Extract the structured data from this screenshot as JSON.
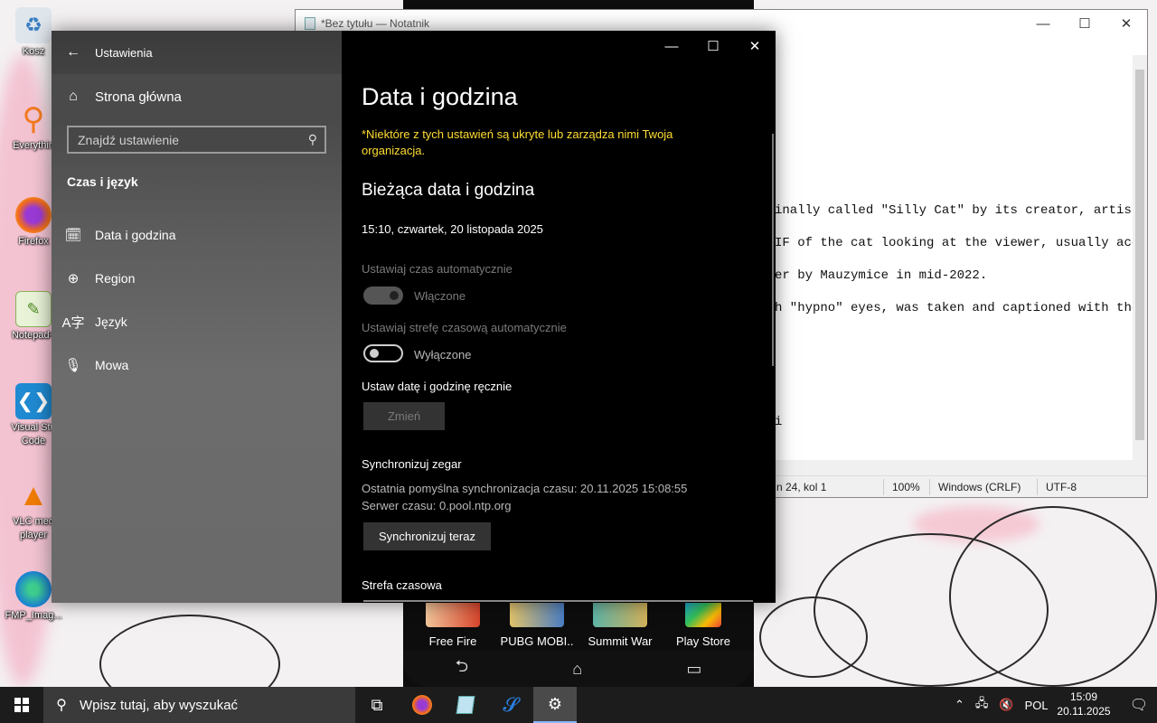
{
  "desktop": {
    "icons": [
      {
        "label": "Kosz",
        "icon": "recycle-bin-icon"
      },
      {
        "label": "Everythin",
        "icon": "everything-search-icon"
      },
      {
        "label": "Firefox",
        "icon": "firefox-icon"
      },
      {
        "label": "Notepad+",
        "icon": "notepad-plus-icon"
      },
      {
        "label": "Visual Stu Code",
        "icon": "vscode-icon"
      },
      {
        "label": "VLC med player",
        "icon": "vlc-icon"
      },
      {
        "label": "FMP_Imag...",
        "icon": "edge-icon"
      }
    ]
  },
  "phone": {
    "apps": [
      {
        "label": "Free Fire"
      },
      {
        "label": "PUBG MOBI.."
      },
      {
        "label": "Summit War"
      },
      {
        "label": "Play Store"
      }
    ]
  },
  "notepad": {
    "title": "*Bez tytułu — Notatnik",
    "lines": [
      "inally called \"Silly Cat\" by its creator, artist",
      "IF of the cat looking at the viewer, usually acco",
      "er by Mauzymice in mid-2022.",
      "h \"hypno\" eyes, was taken and captioned with the",
      "i"
    ],
    "status": {
      "position": "n 24, kol 1",
      "zoom": "100%",
      "line_ending": "Windows (CRLF)",
      "encoding": "UTF-8"
    }
  },
  "settings": {
    "window_title": "Ustawienia",
    "home": "Strona główna",
    "search_placeholder": "Znajdź ustawienie",
    "section": "Czas i język",
    "nav": [
      {
        "label": "Data i godzina",
        "icon": "calendar-clock-icon"
      },
      {
        "label": "Region",
        "icon": "globe-icon"
      },
      {
        "label": "Język",
        "icon": "language-icon"
      },
      {
        "label": "Mowa",
        "icon": "microphone-icon"
      }
    ],
    "page_title": "Data i godzina",
    "warning": "*Niektóre z tych ustawień są ukryte lub zarządza nimi Twoja organizacja.",
    "current_heading": "Bieżąca data i godzina",
    "current_datetime": "15:10, czwartek, 20 listopada 2025",
    "auto_time_label": "Ustawiaj czas automatycznie",
    "auto_time_state": "Włączone",
    "auto_time_on": true,
    "auto_zone_label": "Ustawiaj strefę czasową automatycznie",
    "auto_zone_state": "Wyłączone",
    "auto_zone_on": false,
    "manual_label": "Ustaw datę i godzinę ręcznie",
    "change_button": "Zmień",
    "sync_heading": "Synchronizuj zegar",
    "last_sync": "Ostatnia pomyślna synchronizacja czasu: 20.11.2025 15:08:55",
    "time_server": "Serwer czasu: 0.pool.ntp.org",
    "sync_button": "Synchronizuj teraz",
    "timezone_heading": "Strefa czasowa"
  },
  "taskbar": {
    "search_placeholder": "Wpisz tutaj, aby wyszukać",
    "language": "POL",
    "time": "15:09",
    "date": "20.11.2025"
  }
}
